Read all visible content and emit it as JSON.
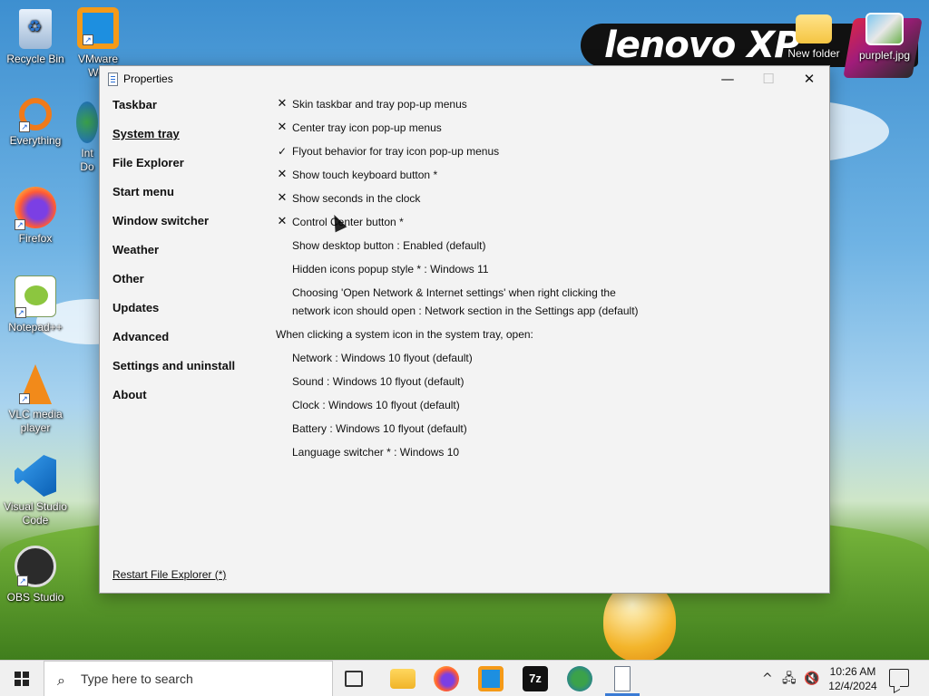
{
  "desktop": {
    "brand_text": "lenovo XP",
    "icons": [
      {
        "label": "Recycle Bin"
      },
      {
        "label": "VMware Wor"
      },
      {
        "label": "Everything"
      },
      {
        "label": "Int Do"
      },
      {
        "label": "Firefox"
      },
      {
        "label": "Notepad++"
      },
      {
        "label": "VLC media player"
      },
      {
        "label": "Visual Studio Code"
      },
      {
        "label": "OBS Studio"
      },
      {
        "label": "New folder"
      },
      {
        "label": "purplef.jpg"
      }
    ]
  },
  "window": {
    "title": "Properties",
    "controls": {
      "minimize": "—",
      "maximize": "☐",
      "close": "✕"
    },
    "nav": [
      {
        "label": "Taskbar"
      },
      {
        "label": "System tray",
        "active": true
      },
      {
        "label": "File Explorer"
      },
      {
        "label": "Start menu"
      },
      {
        "label": "Window switcher"
      },
      {
        "label": "Weather"
      },
      {
        "label": "Other"
      },
      {
        "label": "Updates"
      },
      {
        "label": "Advanced"
      },
      {
        "label": "Settings and uninstall"
      },
      {
        "label": "About"
      }
    ],
    "settings": [
      {
        "mark": "✕",
        "label": "Skin taskbar and tray pop-up menus"
      },
      {
        "mark": "✕",
        "label": "Center tray icon pop-up menus"
      },
      {
        "mark": "✓",
        "label": "Flyout behavior for tray icon pop-up menus"
      },
      {
        "mark": "✕",
        "label": "Show touch keyboard button *"
      },
      {
        "mark": "✕",
        "label": "Show seconds in the clock"
      },
      {
        "mark": "✕",
        "label": "Control Center button *"
      },
      {
        "mark": "",
        "label": "Show desktop button : Enabled (default)"
      },
      {
        "mark": "",
        "label": "Hidden icons popup style * : Windows 11"
      },
      {
        "mark": "",
        "label_line1": "Choosing 'Open Network & Internet settings' when right clicking the",
        "label_line2": "network icon should open : Network section in the Settings app (default)"
      }
    ],
    "section_heading": "When clicking a system icon in the system tray, open:",
    "tray_options": [
      {
        "label": "Network : Windows 10 flyout (default)"
      },
      {
        "label": "Sound : Windows 10 flyout (default)"
      },
      {
        "label": "Clock : Windows 10 flyout (default)"
      },
      {
        "label": "Battery : Windows 10 flyout (default)"
      },
      {
        "label": "Language switcher * : Windows 10"
      }
    ],
    "restart_link": "Restart File Explorer (*)"
  },
  "taskbar": {
    "search_placeholder": "Type here to search",
    "pinned": [
      {
        "name": "task-view-icon"
      },
      {
        "name": "file-explorer-icon"
      },
      {
        "name": "firefox-icon"
      },
      {
        "name": "vmware-icon"
      },
      {
        "name": "7zip-icon",
        "text": "7z"
      },
      {
        "name": "internet-download-manager-icon"
      },
      {
        "name": "properties-app-icon",
        "active": true
      }
    ],
    "tray": {
      "chevron": "^",
      "time": "10:26 AM",
      "date": "12/4/2024"
    }
  },
  "colors": {
    "accent": "#3a7bd5",
    "window_bg": "#f3f3f3",
    "taskbar_bg": "#f0f0f0"
  }
}
